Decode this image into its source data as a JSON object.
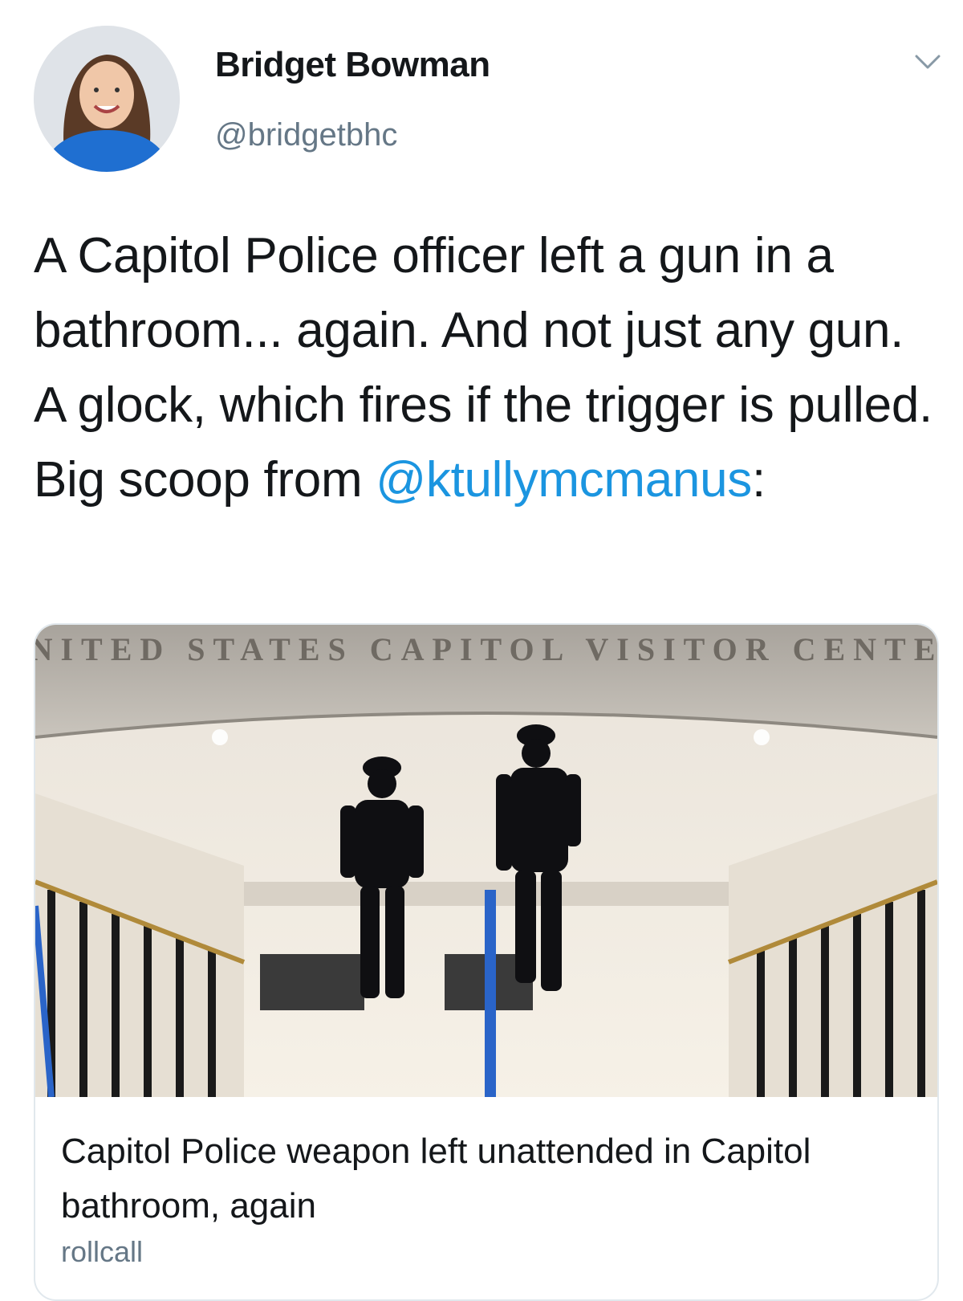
{
  "author": {
    "display_name": "Bridget Bowman",
    "handle": "@bridgetbhc",
    "avatar_icon": "profile-photo"
  },
  "menu_icon": "chevron-down-icon",
  "tweet": {
    "text_before": "A Capitol Police officer left a gun in a bathroom... again. And not just any gun. A glock, which fires if the trigger is pulled. Big scoop from ",
    "mention": "@ktullymcmanus",
    "text_after": ":"
  },
  "card": {
    "image_inscription": "NITED STATES CAPITOL VISITOR CENTE",
    "title": "Capitol Police weapon left unattended in Capitol bathroom, again",
    "domain_partial": "rollcall"
  },
  "colors": {
    "link": "#1b95e0",
    "text": "#14171a",
    "muted": "#657786",
    "border": "#e1e8ed"
  }
}
